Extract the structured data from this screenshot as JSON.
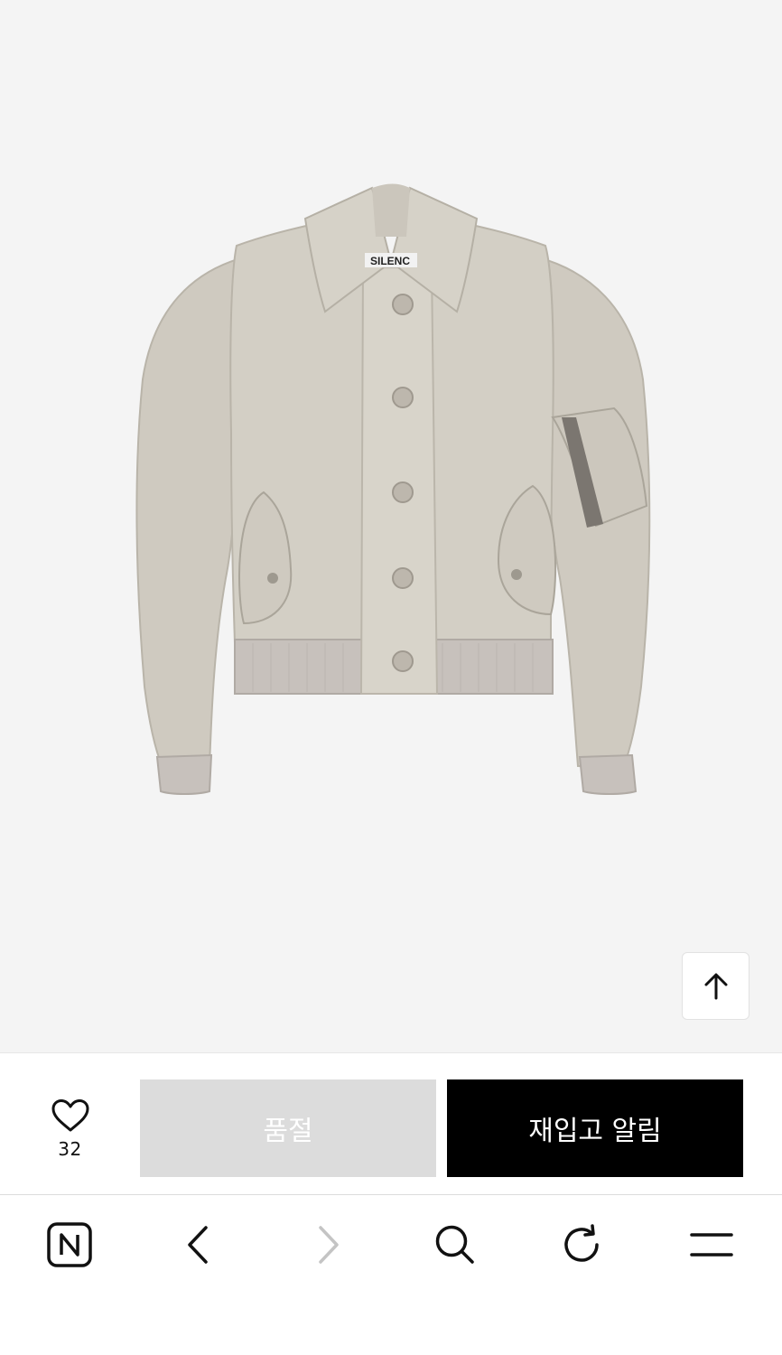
{
  "product": {
    "image_alt": "Bomber jacket product image",
    "brand_label": "SILENC"
  },
  "scroll_top": {
    "icon": "arrow-up-icon"
  },
  "action_bar": {
    "like_icon": "heart-outline-icon",
    "like_count": "32",
    "soldout_label": "품절",
    "restock_label": "재입고 알림"
  },
  "browser_toolbar": {
    "items": [
      {
        "icon": "naver-home-icon"
      },
      {
        "icon": "back-icon"
      },
      {
        "icon": "forward-icon",
        "disabled": true
      },
      {
        "icon": "search-icon"
      },
      {
        "icon": "reload-icon"
      },
      {
        "icon": "menu-icon"
      }
    ]
  },
  "colors": {
    "image_bg": "#f4f4f4",
    "soldout_bg": "#dcdcdc",
    "restock_bg": "#000000",
    "jacket": "#d1cdc3",
    "jacket_shadow": "#b8b3a8",
    "rib": "#c6c0bb"
  }
}
